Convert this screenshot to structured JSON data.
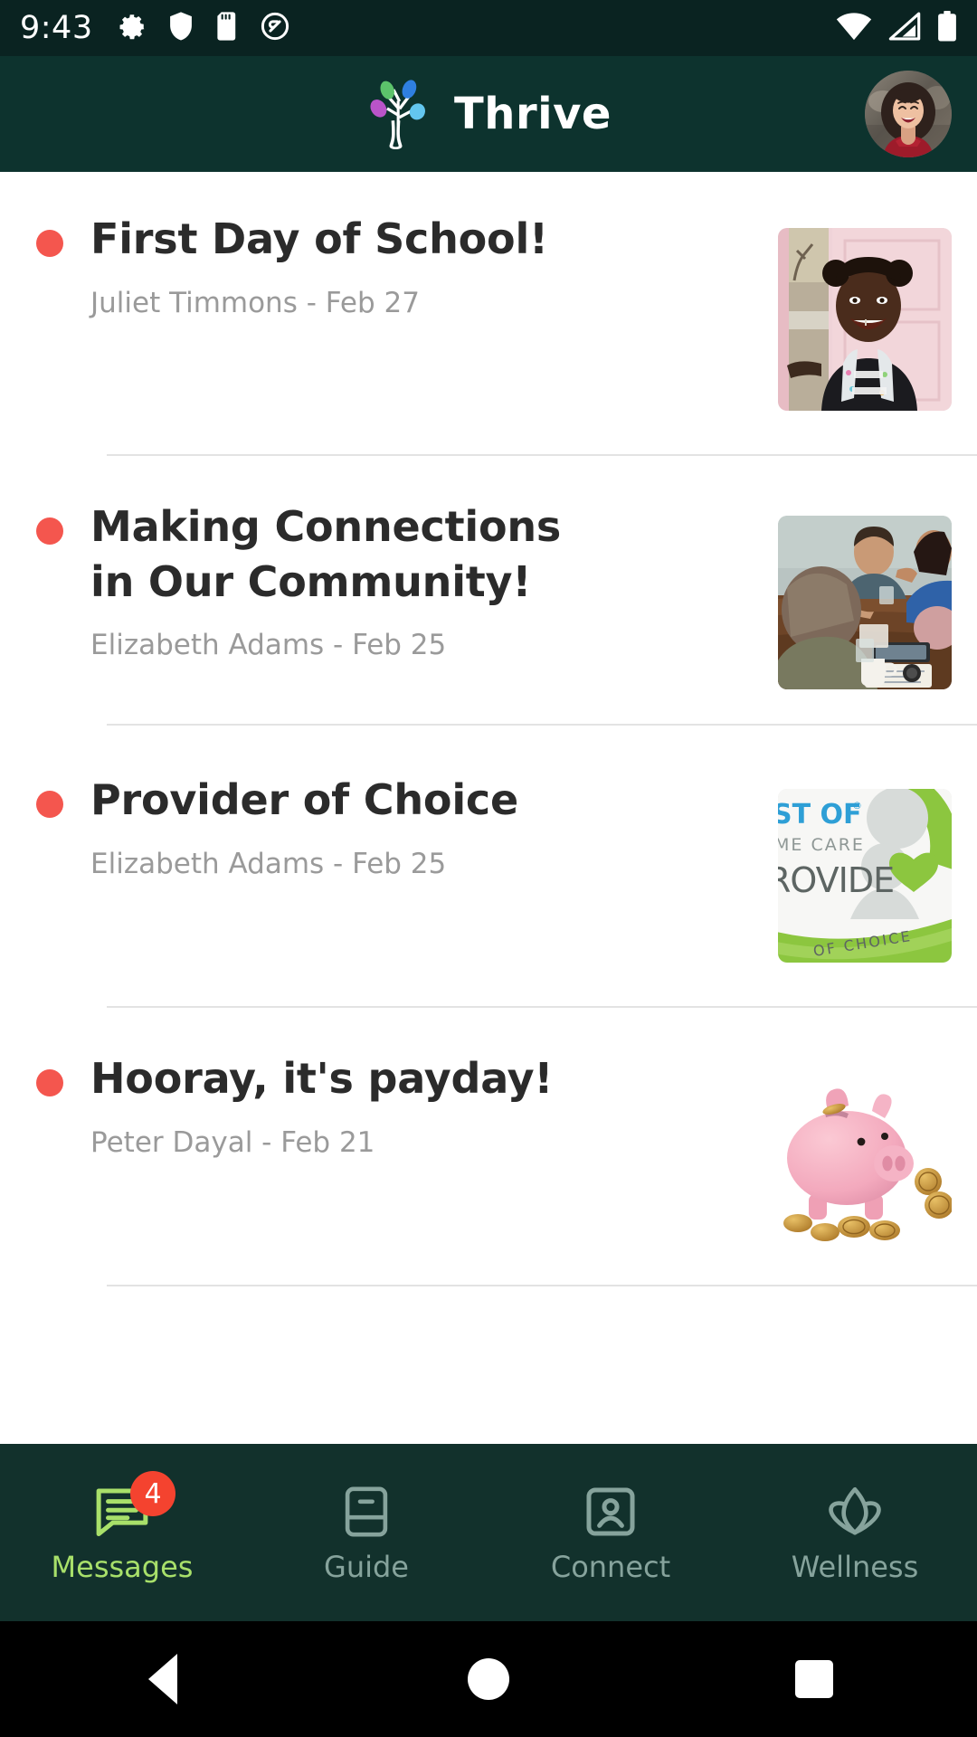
{
  "status_bar": {
    "time": "9:43",
    "left_icons": [
      "gear-icon",
      "shield-icon",
      "sd-card-icon",
      "data-saver-icon"
    ],
    "right_icons": [
      "wifi-icon",
      "cellular-signal-icon",
      "battery-icon"
    ],
    "background_color": "#0a2321"
  },
  "app_bar": {
    "title": "Thrive",
    "logo_icon": "thrive-tree-logo",
    "avatar_icon": "user-avatar-photo",
    "background_color": "#0d332e",
    "logo_colors": {
      "leaf_green": "#5cc36b",
      "leaf_blue": "#2f7fe0",
      "leaf_purple": "#b954c9",
      "leaf_cyan": "#63c6ef",
      "trunk": "#ffffff"
    }
  },
  "messages": {
    "unread_dot_color": "#f4564e",
    "items": [
      {
        "title": "First Day of School!",
        "meta": "Juliet Timmons - Feb 27",
        "author": "Juliet Timmons",
        "date": "Feb 27",
        "unread": true,
        "thumbnail": "child-smiling-pink-door-photo"
      },
      {
        "title": "Making Connections in Our Community!",
        "meta": "Elizabeth Adams - Feb 25",
        "author": "Elizabeth Adams",
        "date": "Feb 25",
        "unread": true,
        "thumbnail": "people-at-table-meeting-photo"
      },
      {
        "title": "Provider of Choice",
        "meta": "Elizabeth Adams - Feb 25",
        "author": "Elizabeth Adams",
        "date": "Feb 25",
        "unread": true,
        "thumbnail": "best-of-home-care-provider-of-choice-badge",
        "thumbnail_text": [
          "ST OF",
          "ME CARE",
          "ROVIDE",
          "OF CHOICE"
        ]
      },
      {
        "title": "Hooray, it's payday!",
        "meta": "Peter Dayal - Feb 21",
        "author": "Peter Dayal",
        "date": "Feb 21",
        "unread": true,
        "thumbnail": "piggy-bank-with-coins-photo"
      }
    ]
  },
  "bottom_nav": {
    "background_color": "#12312c",
    "active_color": "#a8e06a",
    "inactive_color": "#86a39c",
    "badge_color": "#f4432f",
    "items": [
      {
        "label": "Messages",
        "icon": "chat-bubble-icon",
        "active": true,
        "badge": "4"
      },
      {
        "label": "Guide",
        "icon": "book-icon",
        "active": false,
        "badge": ""
      },
      {
        "label": "Connect",
        "icon": "contact-card-icon",
        "active": false,
        "badge": ""
      },
      {
        "label": "Wellness",
        "icon": "lotus-icon",
        "active": false,
        "badge": ""
      }
    ]
  },
  "system_nav": {
    "back_label": "Back",
    "home_label": "Home",
    "recent_label": "Recent apps"
  }
}
